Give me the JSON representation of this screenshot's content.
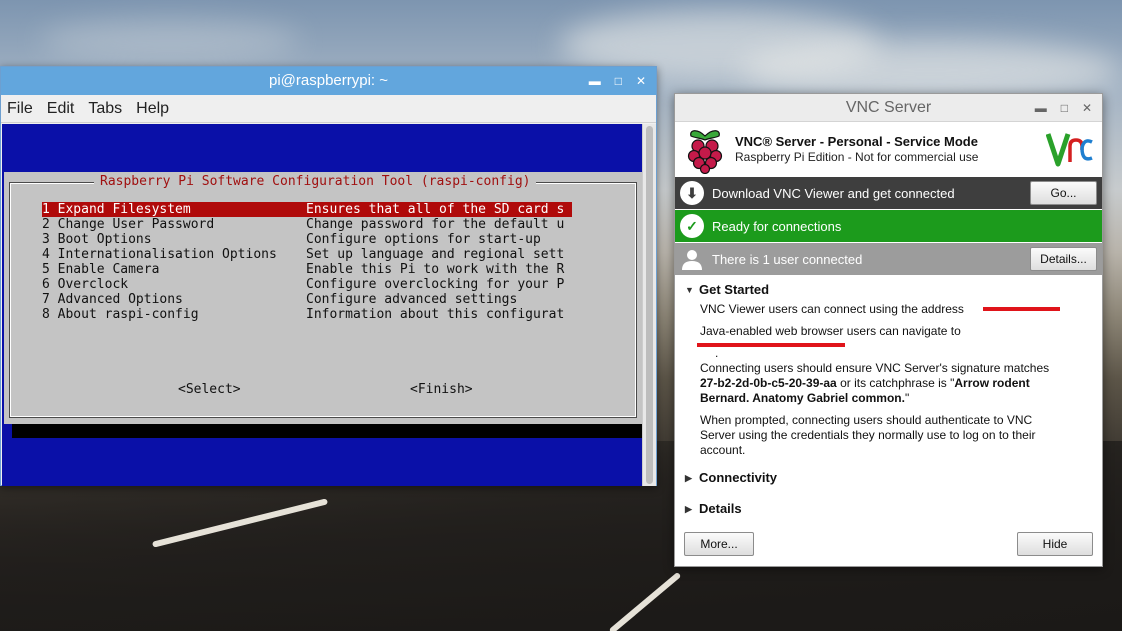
{
  "terminal": {
    "title": "pi@raspberrypi: ~",
    "menu": [
      "File",
      "Edit",
      "Tabs",
      "Help"
    ],
    "dialog_title": "Raspberry Pi Software Configuration Tool (raspi-config)",
    "items": [
      {
        "label": "1 Expand Filesystem",
        "desc": "Ensures that all of the SD card s"
      },
      {
        "label": "2 Change User Password",
        "desc": "Change password for the default u"
      },
      {
        "label": "3 Boot Options",
        "desc": "Configure options for start-up"
      },
      {
        "label": "4 Internationalisation Options",
        "desc": "Set up language and regional sett"
      },
      {
        "label": "5 Enable Camera",
        "desc": "Enable this Pi to work with the R"
      },
      {
        "label": "6 Overclock",
        "desc": "Configure overclocking for your P"
      },
      {
        "label": "7 Advanced Options",
        "desc": "Configure advanced settings"
      },
      {
        "label": "8 About raspi-config",
        "desc": "Information about this configurat"
      }
    ],
    "select_button": "<Select>",
    "finish_button": "<Finish>"
  },
  "vnc": {
    "title": "VNC Server",
    "product_line": "VNC® Server - Personal - Service Mode",
    "edition_line": "Raspberry Pi Edition - Not for commercial use",
    "download_text": "Download VNC Viewer and get connected",
    "go_button": "Go...",
    "ready_text": "Ready for connections",
    "users_text": "There is 1 user connected",
    "details_button": "Details...",
    "get_started": "Get Started",
    "address_text": "VNC Viewer users can connect using the address",
    "java_text": "Java-enabled web browser users can navigate to",
    "period": ".",
    "signature_text_1": "Connecting users should ensure VNC Server's signature matches",
    "signature_value": "27-b2-2d-0b-c5-20-39-aa",
    "signature_text_2": " or its catchphrase is \"",
    "catchphrase_1": "Arrow rodent",
    "catchphrase_2": "Bernard. Anatomy Gabriel common.",
    "quote_end": "\"",
    "auth_text": "When prompted, connecting users should authenticate to VNC Server using the credentials they normally use to log on to their account.",
    "connectivity": "Connectivity",
    "details_section": "Details",
    "more_button": "More...",
    "hide_button": "Hide"
  },
  "colors": {
    "terminal_blue": "#0a10a8",
    "selection_red": "#b00a0a",
    "ready_green": "#1c9b1c",
    "redaction_red": "#e0141a",
    "titlebar_blue": "#62a6dd"
  }
}
